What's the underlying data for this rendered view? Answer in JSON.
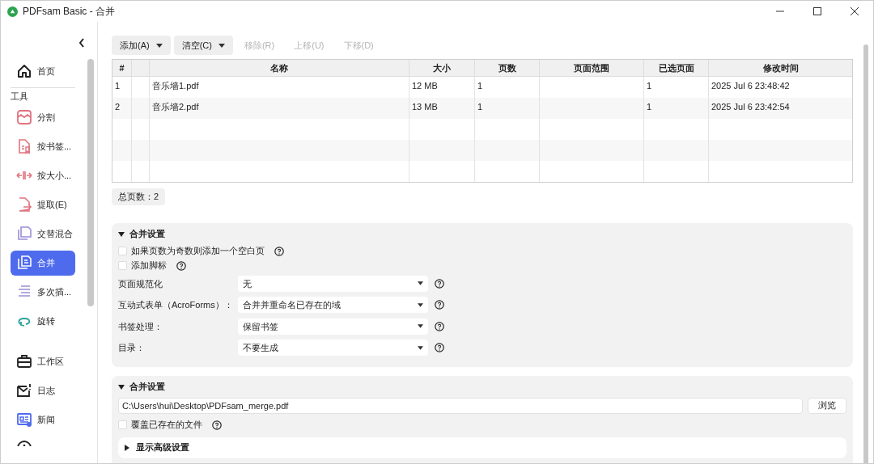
{
  "window": {
    "title": "PDFsam Basic - 合并"
  },
  "sidebar": {
    "items": [
      {
        "kind": "item",
        "label": "首页",
        "selected": false
      },
      {
        "kind": "section",
        "label": "工具"
      },
      {
        "kind": "item",
        "label": "分割",
        "selected": false
      },
      {
        "kind": "item",
        "label": "按书签...",
        "selected": false
      },
      {
        "kind": "item",
        "label": "按大小...",
        "selected": false
      },
      {
        "kind": "item",
        "label": "提取(E)",
        "selected": false
      },
      {
        "kind": "item",
        "label": "交替混合",
        "selected": false
      },
      {
        "kind": "item",
        "label": "合并",
        "selected": true
      },
      {
        "kind": "item",
        "label": "多次插...",
        "selected": false
      },
      {
        "kind": "item",
        "label": "旋转",
        "selected": false
      },
      {
        "kind": "gap"
      },
      {
        "kind": "item",
        "label": "工作区",
        "selected": false
      },
      {
        "kind": "item",
        "label": "日志",
        "selected": false
      },
      {
        "kind": "item",
        "label": "新闻",
        "selected": false
      }
    ]
  },
  "toolbar": [
    {
      "label": "添加(A)",
      "dropdown": true,
      "disabled": false
    },
    {
      "label": "清空(C)",
      "dropdown": true,
      "disabled": false
    },
    {
      "label": "移除(R)",
      "dropdown": false,
      "disabled": true
    },
    {
      "label": "上移(U)",
      "dropdown": false,
      "disabled": true
    },
    {
      "label": "下移(D)",
      "dropdown": false,
      "disabled": true
    }
  ],
  "table": {
    "columns": [
      "#",
      "名称",
      "大小",
      "页数",
      "页面范围",
      "已选页面",
      "修改时间"
    ],
    "rows": [
      {
        "index": "1",
        "name": "音乐墙1.pdf",
        "size": "12 MB",
        "pages": "1",
        "selected_pages": "1",
        "modified": "2025 Jul 6 23:48:42"
      },
      {
        "index": "2",
        "name": "音乐墙2.pdf",
        "size": "13 MB",
        "pages": "1",
        "selected_pages": "1",
        "modified": "2025 Jul 6 23:42:54"
      }
    ]
  },
  "total_pages": "总页数：2",
  "merge_settings": {
    "title": "合并设置",
    "expanded": true,
    "checkboxes": [
      {
        "label": "如果页数为奇数则添加一个空白页",
        "checked": false
      },
      {
        "label": "添加脚标",
        "checked": false
      }
    ],
    "selects": [
      {
        "label": "页面规范化",
        "value": "无"
      },
      {
        "label": "互动式表单（AcroForms）：",
        "value": "合并并重命名已存在的域"
      },
      {
        "label": "书签处理：",
        "value": "保留书签"
      },
      {
        "label": "目录：",
        "value": "不要生成"
      }
    ]
  },
  "output_settings": {
    "title": "合并设置",
    "expanded": true,
    "path": "C:\\Users\\hui\\Desktop\\PDFsam_merge.pdf",
    "browse": "浏览",
    "overwrite": {
      "label": "覆盖已存在的文件",
      "checked": false
    },
    "advanced": {
      "label": "显示高级设置",
      "expanded": false
    }
  }
}
